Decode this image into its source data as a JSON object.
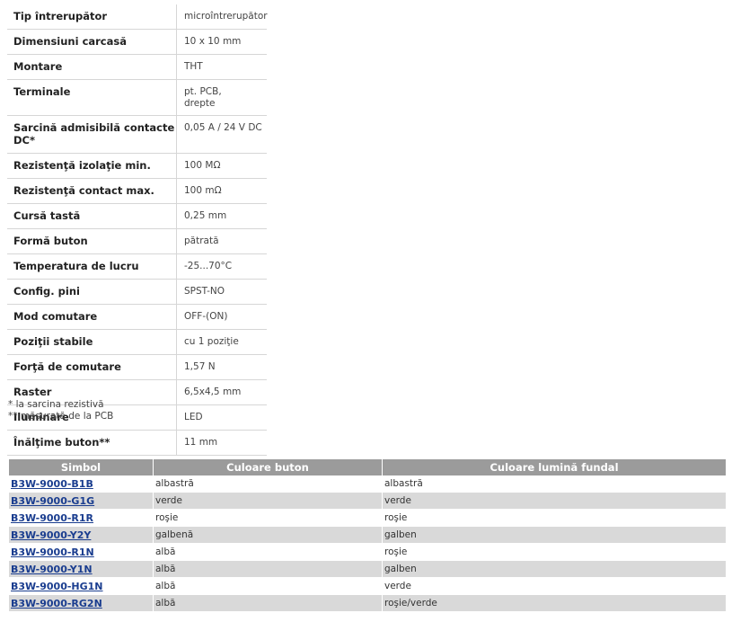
{
  "params": [
    {
      "name": "Tip întrerupător",
      "value": "microîntrerupător"
    },
    {
      "name": "Dimensiuni carcasă",
      "value": "10 x 10 mm"
    },
    {
      "name": "Montare",
      "value": "THT"
    },
    {
      "name": "Terminale",
      "value": "pt. PCB,\ndrepte"
    },
    {
      "name": "Sarcină admisibilă contacte DC*",
      "value": "0,05 A / 24 V DC"
    },
    {
      "name": "Rezistenţă izolaţie min.",
      "value": "100 MΩ"
    },
    {
      "name": "Rezistenţă contact max.",
      "value": "100 mΩ"
    },
    {
      "name": "Cursă tastă",
      "value": "0,25 mm"
    },
    {
      "name": "Formă buton",
      "value": "pătrată"
    },
    {
      "name": "Temperatura de lucru",
      "value": "-25...70°C"
    },
    {
      "name": "Config. pini",
      "value": "SPST-NO"
    },
    {
      "name": "Mod comutare",
      "value": "OFF-(ON)"
    },
    {
      "name": "Poziţii stabile",
      "value": "cu 1 poziţie"
    },
    {
      "name": "Forţă de comutare",
      "value": "1,57 N"
    },
    {
      "name": "Raster",
      "value": "6,5x4,5 mm"
    },
    {
      "name": "Iluminare",
      "value": "LED"
    },
    {
      "name": "Înălţime buton**",
      "value": "11 mm"
    }
  ],
  "notes": [
    "* la sarcina rezistivă",
    "** măsurată de la PCB"
  ],
  "variants": {
    "headers": [
      "Simbol",
      "Culoare buton",
      "Culoare lumină fundal"
    ],
    "rows": [
      {
        "symbol": "B3W-9000-B1B",
        "button": "albastră",
        "light": "albastră"
      },
      {
        "symbol": "B3W-9000-G1G",
        "button": "verde",
        "light": "verde"
      },
      {
        "symbol": "B3W-9000-R1R",
        "button": "roşie",
        "light": "roşie"
      },
      {
        "symbol": "B3W-9000-Y2Y",
        "button": "galbenă",
        "light": "galben"
      },
      {
        "symbol": "B3W-9000-R1N",
        "button": "albă",
        "light": "roşie"
      },
      {
        "symbol": "B3W-9000-Y1N",
        "button": "albă",
        "light": "galben"
      },
      {
        "symbol": "B3W-9000-HG1N",
        "button": "albă",
        "light": "verde"
      },
      {
        "symbol": "B3W-9000-RG2N",
        "button": "albă",
        "light": "roşie/verde"
      }
    ]
  }
}
